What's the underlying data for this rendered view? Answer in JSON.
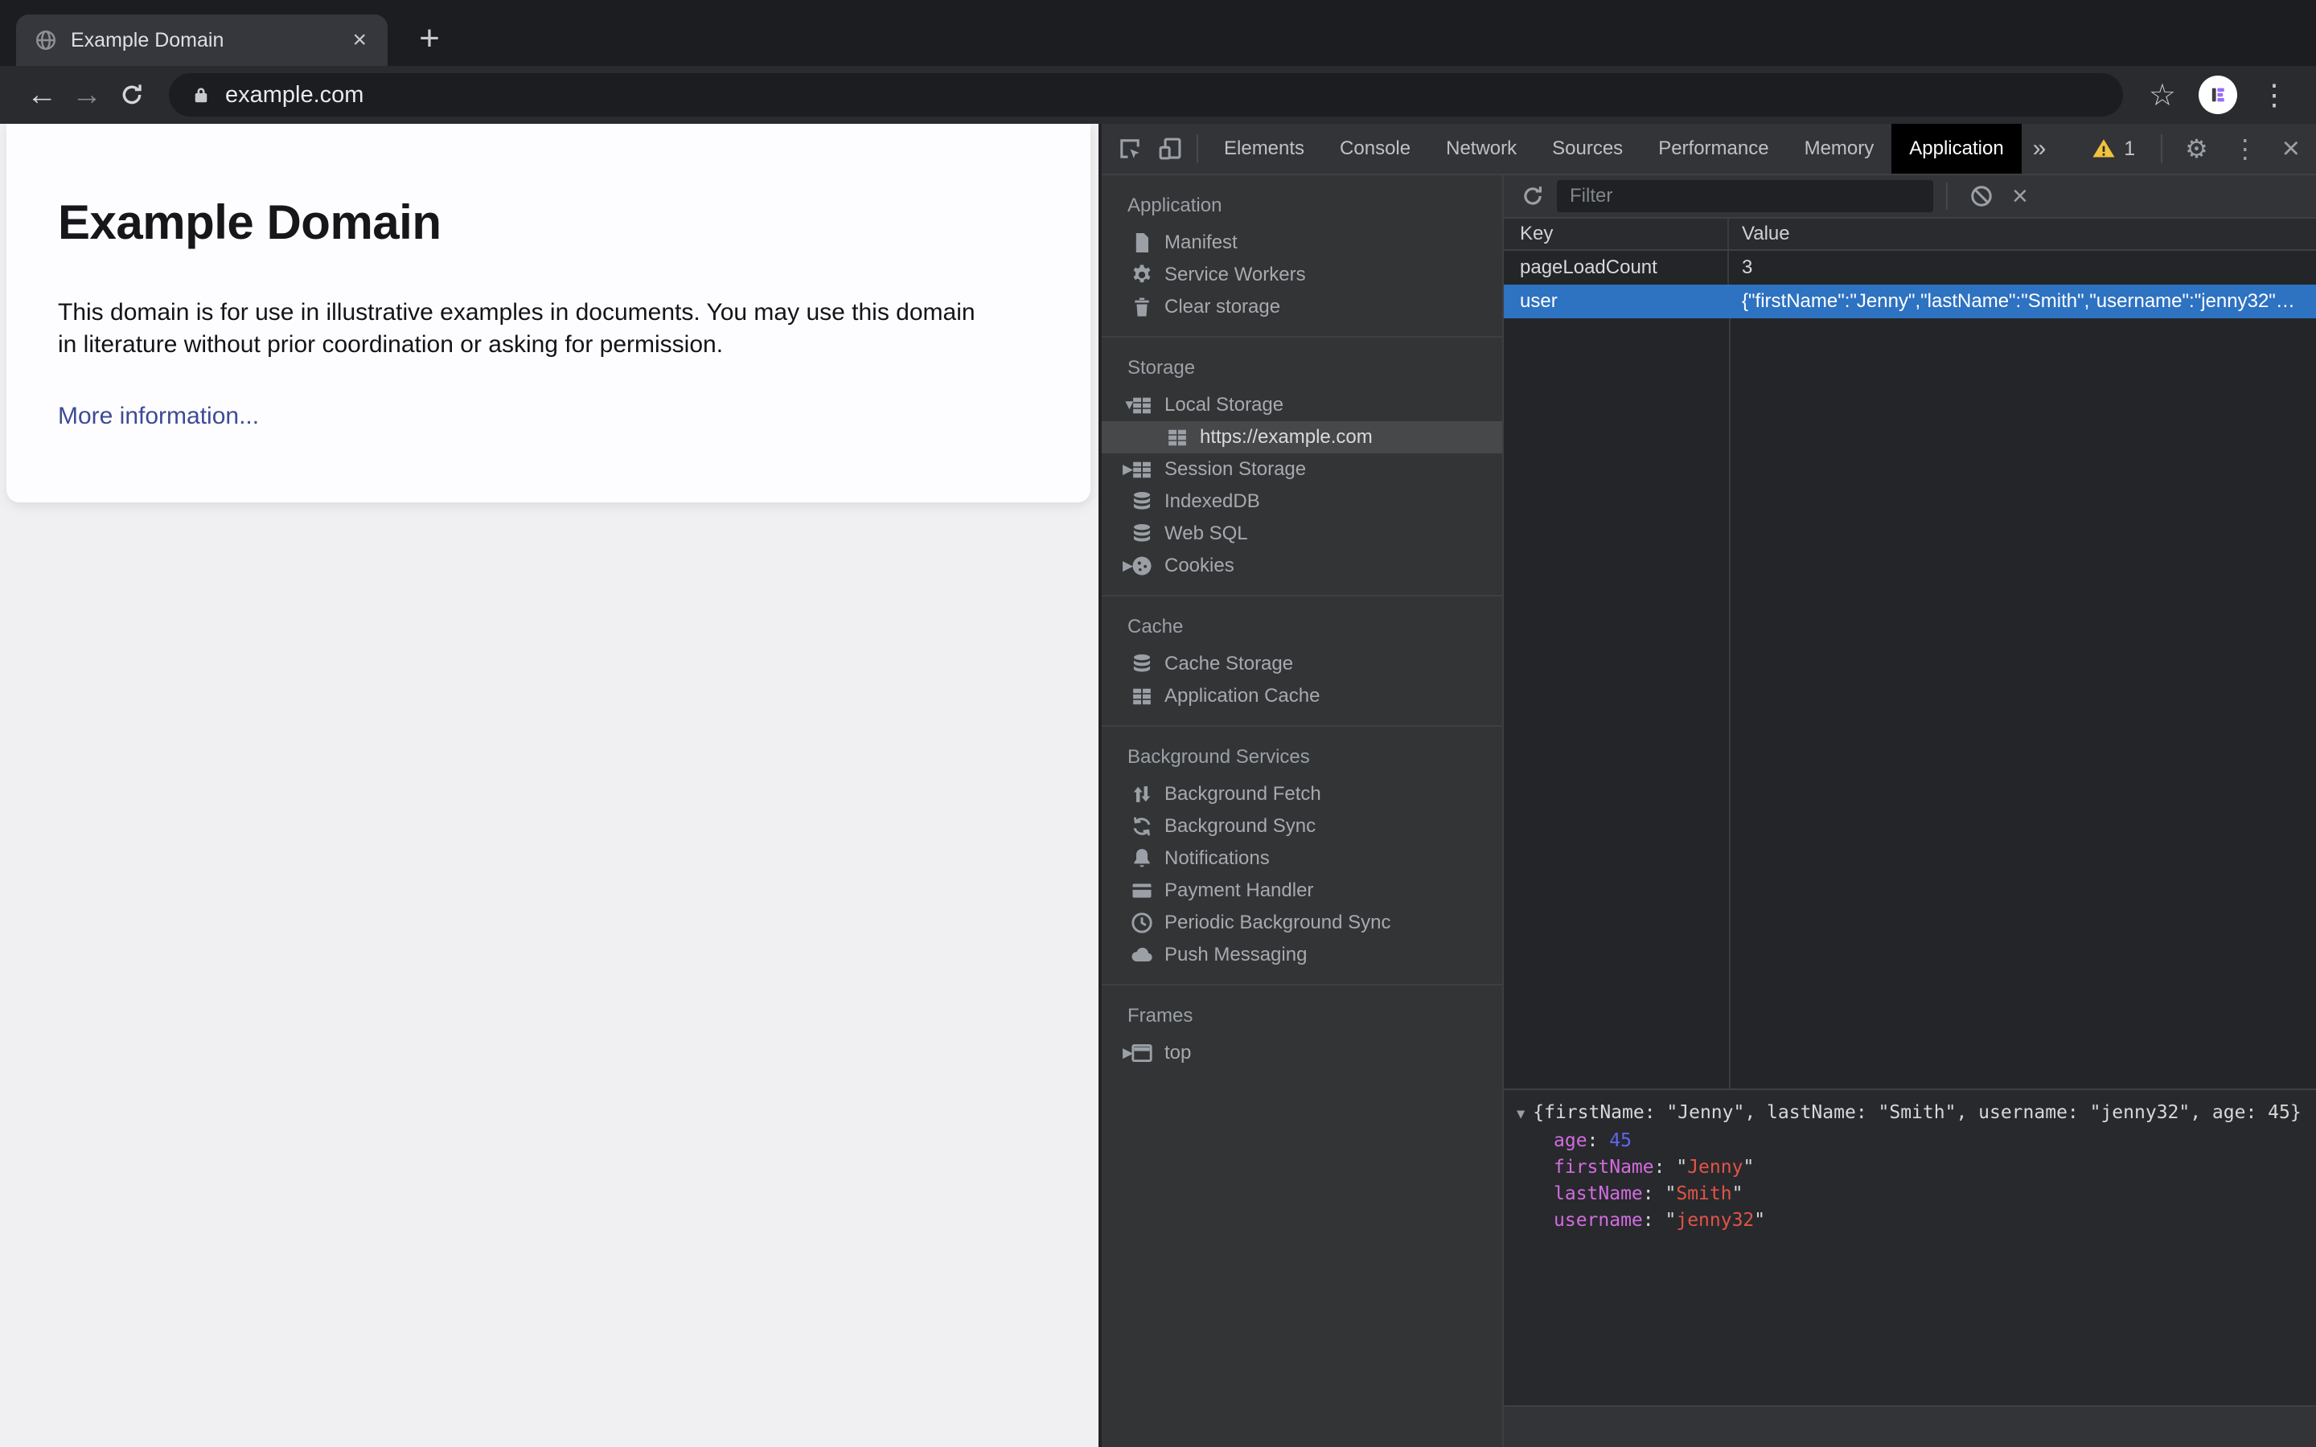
{
  "browser": {
    "tab_title": "Example Domain",
    "url": "example.com",
    "profile_letter": "E"
  },
  "page": {
    "heading": "Example Domain",
    "paragraph": "This domain is for use in illustrative examples in documents. You may use this domain in literature without prior coordination or asking for permission.",
    "link_label": "More information..."
  },
  "devtools": {
    "tabs": [
      "Elements",
      "Console",
      "Network",
      "Sources",
      "Performance",
      "Memory",
      "Application"
    ],
    "selected_tab": "Application",
    "warning_count": "1",
    "sidebar": {
      "sections": [
        {
          "title": "Application",
          "items": [
            {
              "label": "Manifest",
              "icon": "doc"
            },
            {
              "label": "Service Workers",
              "icon": "gear"
            },
            {
              "label": "Clear storage",
              "icon": "trash"
            }
          ]
        },
        {
          "title": "Storage",
          "items": [
            {
              "label": "Local Storage",
              "icon": "table",
              "expander": "▼"
            },
            {
              "label": "https://example.com",
              "icon": "table",
              "indent": 2,
              "selected": true
            },
            {
              "label": "Session Storage",
              "icon": "table",
              "expander": "▶"
            },
            {
              "label": "IndexedDB",
              "icon": "database"
            },
            {
              "label": "Web SQL",
              "icon": "database"
            },
            {
              "label": "Cookies",
              "icon": "cookie",
              "expander": "▶"
            }
          ]
        },
        {
          "title": "Cache",
          "items": [
            {
              "label": "Cache Storage",
              "icon": "database"
            },
            {
              "label": "Application Cache",
              "icon": "table"
            }
          ]
        },
        {
          "title": "Background Services",
          "items": [
            {
              "label": "Background Fetch",
              "icon": "updown"
            },
            {
              "label": "Background Sync",
              "icon": "sync"
            },
            {
              "label": "Notifications",
              "icon": "bell"
            },
            {
              "label": "Payment Handler",
              "icon": "card"
            },
            {
              "label": "Periodic Background Sync",
              "icon": "clock"
            },
            {
              "label": "Push Messaging",
              "icon": "cloud"
            }
          ]
        },
        {
          "title": "Frames",
          "items": [
            {
              "label": "top",
              "icon": "frame",
              "expander": "▶"
            }
          ]
        }
      ]
    },
    "storage_panel": {
      "filter_placeholder": "Filter",
      "columns": [
        "Key",
        "Value"
      ],
      "rows": [
        {
          "key": "pageLoadCount",
          "value": "3",
          "selected": false
        },
        {
          "key": "user",
          "value": "{\"firstName\":\"Jenny\",\"lastName\":\"Smith\",\"username\":\"jenny32\"…",
          "selected": true
        }
      ],
      "preview": {
        "summary": "{firstName: \"Jenny\", lastName: \"Smith\", username: \"jenny32\", age: 45}",
        "properties": [
          {
            "name": "age",
            "value": "45",
            "type": "number"
          },
          {
            "name": "firstName",
            "value": "Jenny",
            "type": "string"
          },
          {
            "name": "lastName",
            "value": "Smith",
            "type": "string"
          },
          {
            "name": "username",
            "value": "jenny32",
            "type": "string"
          }
        ]
      }
    },
    "colors": {
      "selected_row_blue": "#2e72c2",
      "warning_yellow": "#f2c13d",
      "syntax_property": "#d26ce0",
      "syntax_number": "#5d67f2",
      "syntax_string": "#e1544a",
      "selected_tab_bg": "#000000"
    }
  },
  "page_colors": {
    "link_blue": "#3e4a96",
    "page_bg": "#f0f0f2",
    "card_bg": "#fdfdff"
  }
}
